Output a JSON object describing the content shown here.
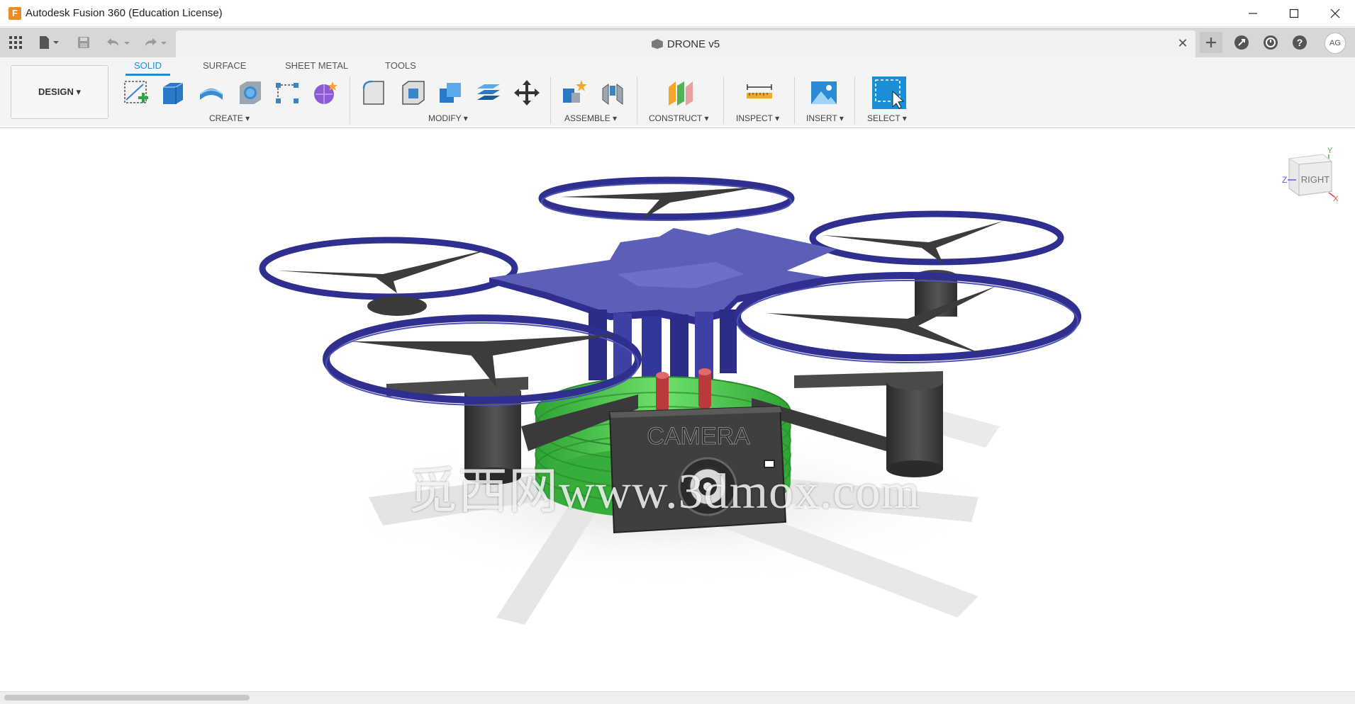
{
  "window": {
    "title": "Autodesk Fusion 360 (Education License)",
    "logo_letter": "F"
  },
  "document": {
    "title": "DRONE v5"
  },
  "user": {
    "initials": "AG"
  },
  "workspace": {
    "label": "DESIGN ▾"
  },
  "tabs": [
    {
      "label": "SOLID",
      "active": true
    },
    {
      "label": "SURFACE",
      "active": false
    },
    {
      "label": "SHEET METAL",
      "active": false
    },
    {
      "label": "TOOLS",
      "active": false
    }
  ],
  "groups": {
    "create": "CREATE ▾",
    "modify": "MODIFY ▾",
    "assemble": "ASSEMBLE ▾",
    "construct": "CONSTRUCT ▾",
    "inspect": "INSPECT ▾",
    "insert": "INSERT ▾",
    "select": "SELECT ▾"
  },
  "viewcube": {
    "face": "RIGHT",
    "axis_y": "Y",
    "axis_z": "Z",
    "axis_x": "X"
  },
  "model": {
    "camera_label": "CAMERA"
  },
  "watermark": "觅西网www.3dmox.com",
  "colors": {
    "accent": "#1a8fd8",
    "rotor_guard": "#2e2f8f",
    "body": "#5b5fb8",
    "battery": "#45c948",
    "frame": "#3a3a3a"
  }
}
